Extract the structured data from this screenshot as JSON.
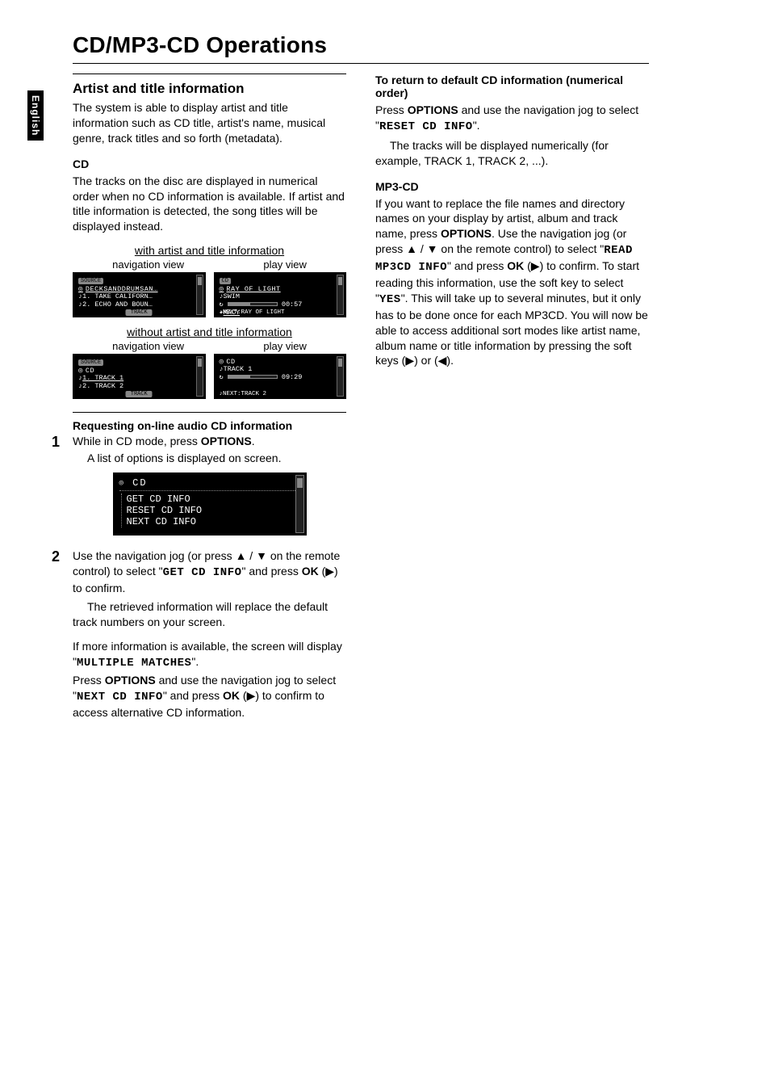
{
  "page_title": "CD/MP3-CD Operations",
  "language_tab": "English",
  "left": {
    "section_heading": "Artist and title information",
    "intro": "The system is able to display artist and title information such as CD title, artist's name, musical genre, track titles and so forth (metadata).",
    "cd_heading": "CD",
    "cd_text": "The tracks on the disc are displayed in numerical order when no CD information is available. If artist and title information is detected, the song titles will be displayed instead.",
    "with_caption": "with artist and title information",
    "without_caption": "without artist and title information",
    "nav_label": "navigation view",
    "play_label": "play view",
    "screen_with_nav": {
      "tab": "SOURCE",
      "disc": "DECKSANDDRUMSAN…",
      "line1": "1. TAKE CALIFORN…",
      "line2": "2. ECHO AND BOUN…",
      "foot": "TRACK"
    },
    "screen_with_play": {
      "tab": "CD",
      "title": "RAY OF LIGHT",
      "track": "SWIM",
      "time": "00:57",
      "artist": "MACY",
      "next": "NEXT:RAY OF LIGHT"
    },
    "screen_without_nav": {
      "tab": "SOURCE",
      "disc": "CD",
      "line1": "1. TRACK 1",
      "line2": "2. TRACK 2",
      "foot": "TRACK"
    },
    "screen_without_play": {
      "disc": "CD",
      "track": "TRACK 1",
      "time": "09:29",
      "next": "NEXT:TRACK 2"
    },
    "request_heading": "Requesting on-line audio CD information",
    "step1_line1_a": "While in CD mode, press ",
    "step1_line1_b": "OPTIONS",
    "step1_line1_c": ".",
    "step1_line2": "A list of options is displayed on screen.",
    "big_screen": {
      "disc": "CD",
      "line1": "GET CD INFO",
      "line2": "RESET CD INFO",
      "line3": "NEXT CD INFO"
    },
    "step2_a": "Use the navigation jog (or press ",
    "step2_b": " on the remote control) to select \"",
    "step2_cmd": "GET CD INFO",
    "step2_c": "\" and press ",
    "step2_ok": "OK",
    "step2_d": " (▶) to confirm.",
    "step2_result": "The retrieved information will replace the default track numbers on your screen.",
    "step2_more_a": "If more information is available, the screen will display \"",
    "step2_more_cmd": "MULTIPLE MATCHES",
    "step2_more_b": "\".",
    "step2_press_a": "Press ",
    "step2_press_opt": "OPTIONS",
    "step2_press_b": " and use the navigation jog to select \"",
    "step2_press_cmd": "NEXT CD INFO",
    "step2_press_c": "\" and press ",
    "step2_press_ok": "OK",
    "step2_press_d": " (▶) to confirm to access alternative CD information."
  },
  "right": {
    "return_heading": "To return to default CD information (numerical order)",
    "return_a": "Press ",
    "return_opt": "OPTIONS",
    "return_b": " and use the navigation jog to select \"",
    "return_cmd": "RESET CD INFO",
    "return_c": "\".",
    "return_result": "The tracks will be displayed numerically (for example, TRACK 1, TRACK 2, ...).",
    "mp3_heading": "MP3-CD",
    "mp3_a": "If you want to replace the file names and directory names on your display by artist, album and track name, press ",
    "mp3_opt": "OPTIONS",
    "mp3_b": ".  Use the navigation jog (or press ",
    "mp3_c": " on the remote control) to select \"",
    "mp3_cmd1": "READ MP3CD INFO",
    "mp3_d": "\" and press ",
    "mp3_ok": "OK",
    "mp3_e": " (▶) to confirm.  To start reading this information, use the soft key to select \"",
    "mp3_cmd2": "YES",
    "mp3_f": "\". This will take up to several minutes, but it only has to be done once for each MP3CD.  You will now be able to access additional sort modes like artist name, album name or title information by pressing the soft keys (▶) or (◀)."
  },
  "glyphs": {
    "up": "▲",
    "down": "▼",
    "slash": " / "
  }
}
